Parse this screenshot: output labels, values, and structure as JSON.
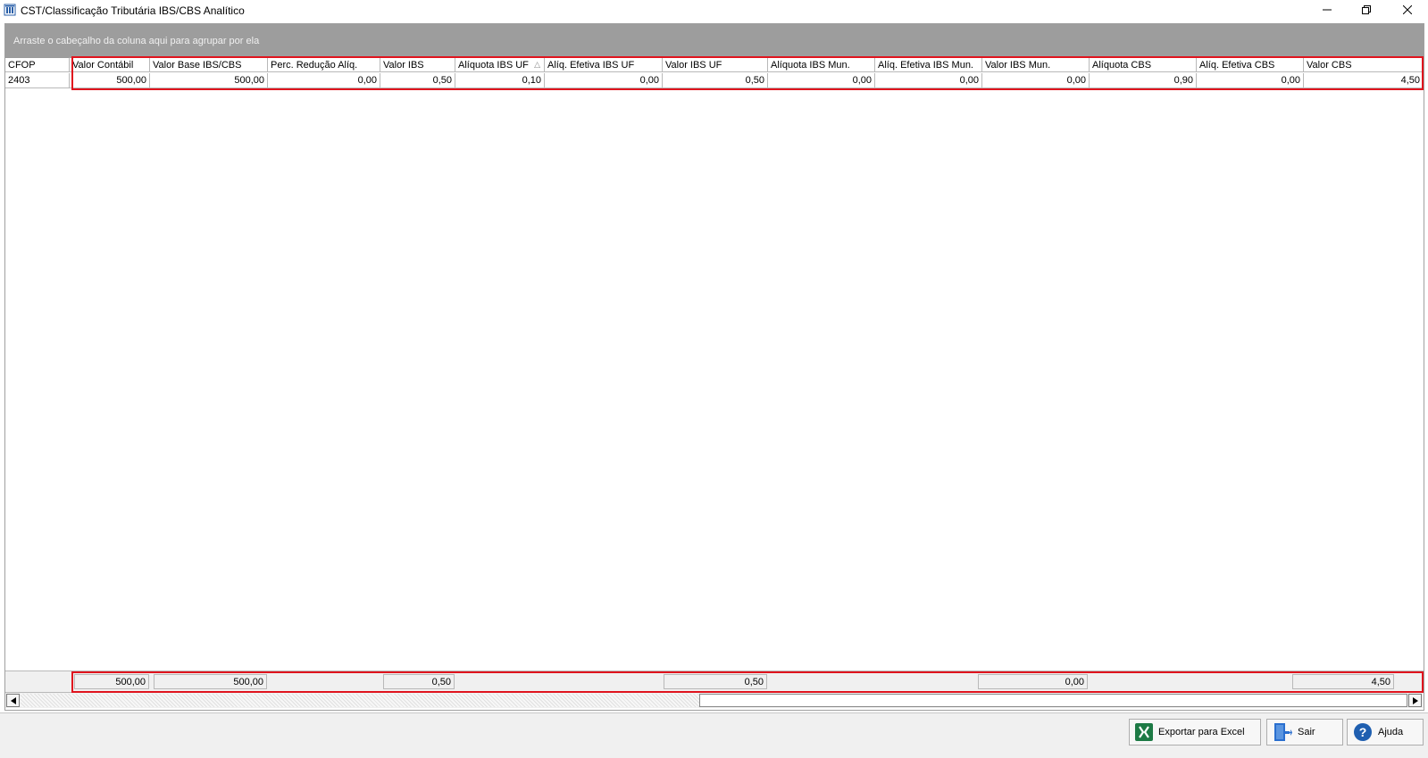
{
  "window": {
    "title": "CST/Classificação Tributária IBS/CBS Analítico",
    "controls": [
      "minimize-icon",
      "restore-icon",
      "close-icon"
    ]
  },
  "grid": {
    "group_panel_text": "Arraste o cabeçalho da coluna aqui para agrupar por ela",
    "columns": [
      "CFOP",
      "Valor Contábil",
      "Valor Base IBS/CBS",
      "Perc. Redução Alíq.",
      "Valor IBS",
      "Alíquota IBS UF",
      "Alíq. Efetiva IBS UF",
      "Valor IBS UF",
      "Alíquota IBS Mun.",
      "Alíq. Efetiva IBS Mun.",
      "Valor IBS Mun.",
      "Alíquota CBS",
      "Alíq. Efetiva CBS",
      "Valor CBS"
    ],
    "sorted_column": "Alíquota IBS UF",
    "sort_direction": "ascending",
    "rows": [
      [
        "2403",
        "500,00",
        "500,00",
        "0,00",
        "0,50",
        "0,10",
        "0,00",
        "0,50",
        "0,00",
        "0,00",
        "0,00",
        "0,90",
        "0,00",
        "4,50"
      ]
    ],
    "footer_totals": {
      "Valor Contábil": "500,00",
      "Valor Base IBS/CBS": "500,00",
      "Valor IBS": "0,50",
      "Valor IBS UF": "0,50",
      "Valor IBS Mun.": "0,00",
      "Valor CBS": "4,50"
    }
  },
  "buttons": {
    "excel": "Exportar para Excel",
    "sair": "Sair",
    "ajuda": "Ajuda"
  },
  "colors": {
    "highlight": "#e0141e",
    "group_panel": "#9d9d9d",
    "excel_green": "#1d7a45",
    "help_blue": "#1f5fb0"
  }
}
